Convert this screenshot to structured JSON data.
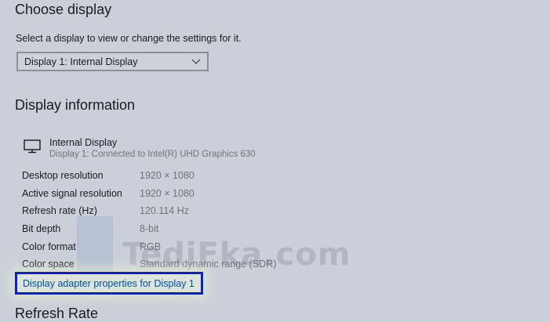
{
  "choose_display": {
    "heading": "Choose display",
    "prompt": "Select a display to view or change the settings for it.",
    "selected_display": "Display 1: Internal Display"
  },
  "display_information": {
    "heading": "Display information",
    "display_name": "Internal Display",
    "display_subtitle": "Display 1: Connected to Intel(R) UHD Graphics 630",
    "rows": [
      {
        "label": "Desktop resolution",
        "value": "1920 × 1080"
      },
      {
        "label": "Active signal resolution",
        "value": "1920 × 1080"
      },
      {
        "label": "Refresh rate (Hz)",
        "value": "120.114 Hz"
      },
      {
        "label": "Bit depth",
        "value": "8-bit"
      },
      {
        "label": "Color format",
        "value": "RGB"
      },
      {
        "label": "Color space",
        "value": "Standard dynamic range (SDR)"
      }
    ],
    "adapter_link": "Display adapter properties for Display 1"
  },
  "refresh_rate": {
    "heading": "Refresh Rate"
  },
  "watermark": {
    "text": "TediFka.com"
  },
  "icons": {
    "monitor": "monitor-icon",
    "dropdown": "chevron-down-icon"
  },
  "colors": {
    "background": "#cbcfd9",
    "link": "#0050a8",
    "highlight_border": "#0a1fd6",
    "secondary_text": "#6f737a"
  }
}
